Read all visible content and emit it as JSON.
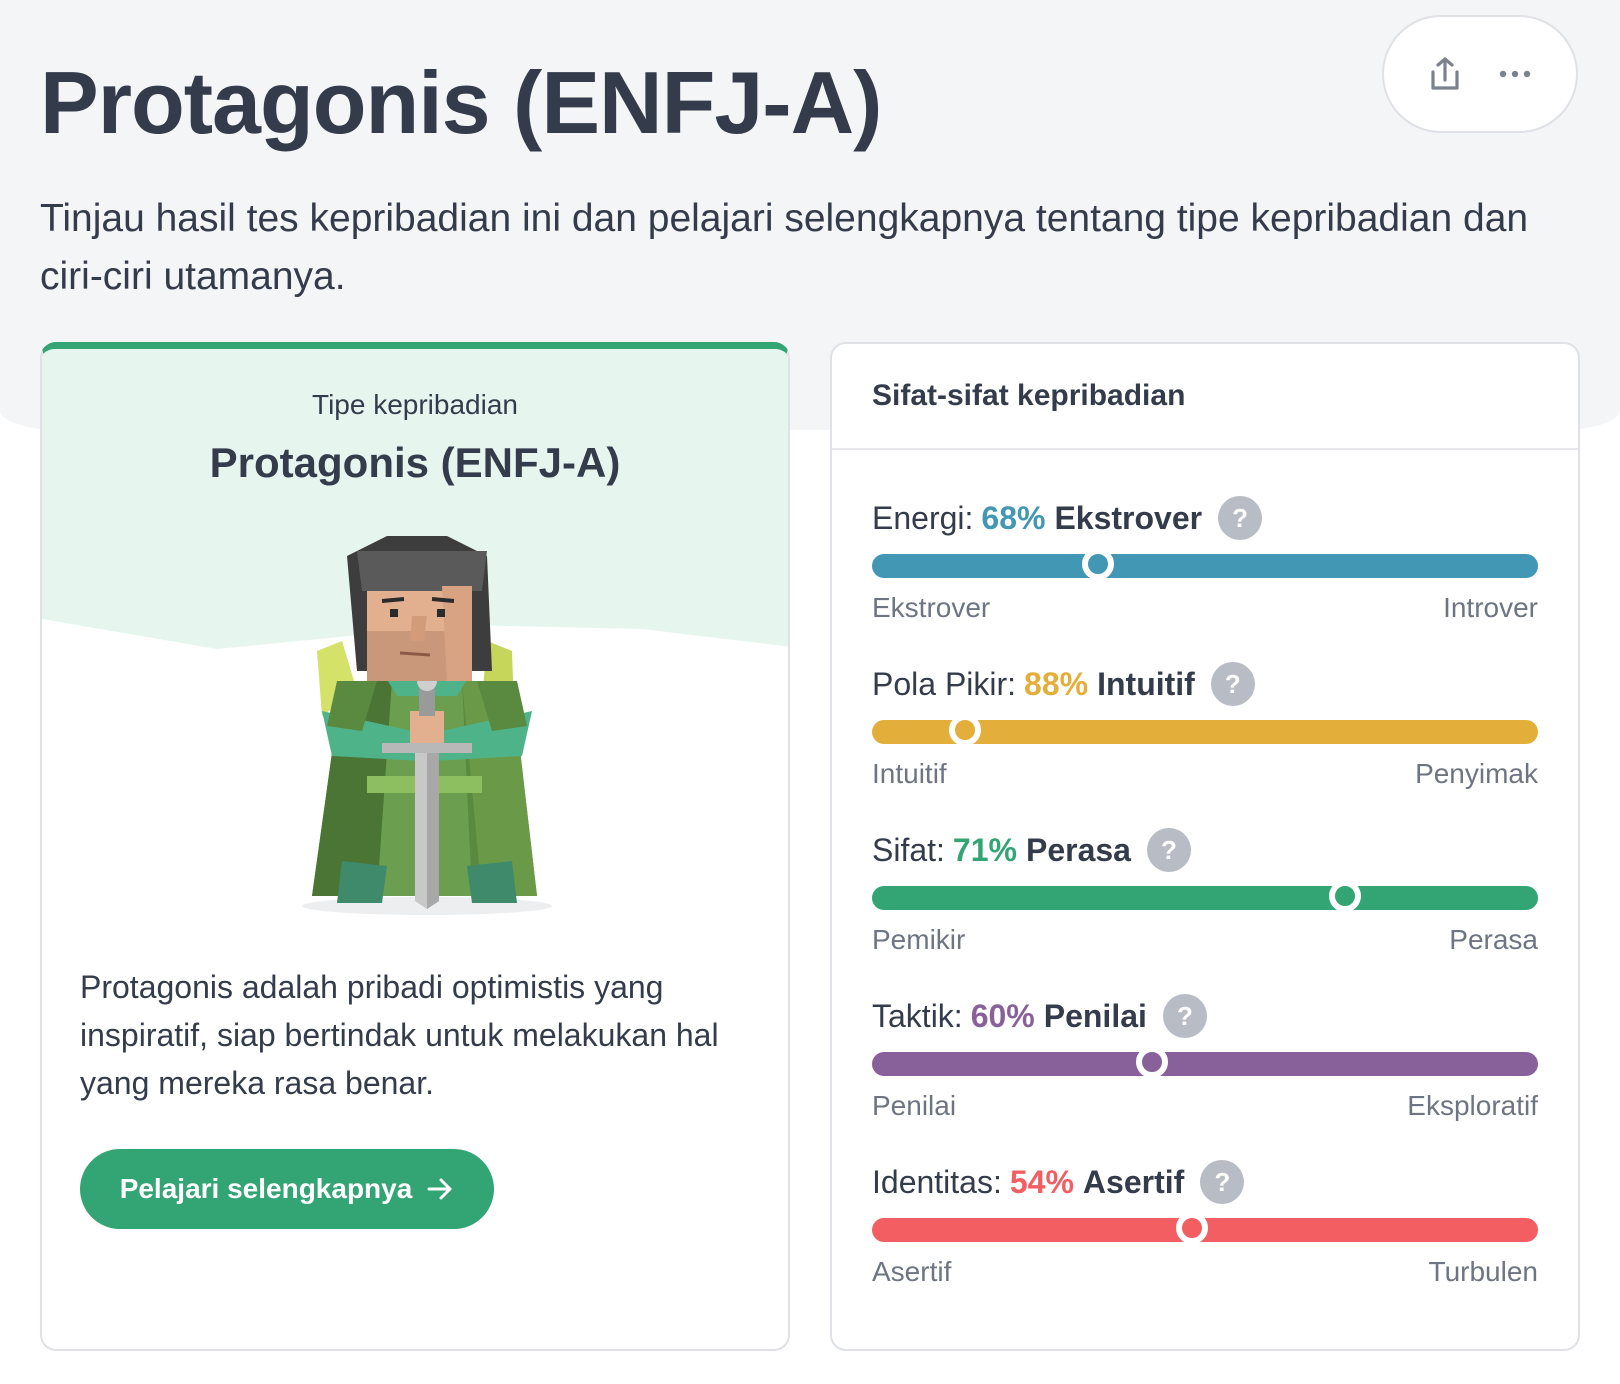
{
  "header": {
    "title": "Protagonis (ENFJ-A)",
    "subtitle": "Tinjau hasil tes kepribadian ini dan pelajari selengkapnya tentang tipe kepribadian dan ciri-ciri utamanya.",
    "share_icon": "share-icon",
    "more_icon": "more-horizontal-icon"
  },
  "type_card": {
    "label": "Tipe kepribadian",
    "name": "Protagonis (ENFJ-A)",
    "avatar_icon": "protagonist-character-illustration",
    "description": "Protagonis adalah pribadi optimistis yang inspiratif, siap bertindak untuk melakukan hal yang mereka rasa benar.",
    "button_label": "Pelajari selengkapnya",
    "button_icon": "arrow-right-icon",
    "accent": "#33a474"
  },
  "traits": {
    "title": "Sifat-sifat kepribadian",
    "items": [
      {
        "label": "Energi:",
        "percent": "68%",
        "trait": "Ekstrover",
        "left": "Ekstrover",
        "right": "Introver",
        "color": "#4298b4",
        "position": 0.34
      },
      {
        "label": "Pola Pikir:",
        "percent": "88%",
        "trait": "Intuitif",
        "left": "Intuitif",
        "right": "Penyimak",
        "color": "#e4ae3a",
        "position": 0.14
      },
      {
        "label": "Sifat:",
        "percent": "71%",
        "trait": "Perasa",
        "left": "Pemikir",
        "right": "Perasa",
        "color": "#33a474",
        "position": 0.71
      },
      {
        "label": "Taktik:",
        "percent": "60%",
        "trait": "Penilai",
        "left": "Penilai",
        "right": "Eksploratif",
        "color": "#88619a",
        "position": 0.42
      },
      {
        "label": "Identitas:",
        "percent": "54%",
        "trait": "Asertif",
        "left": "Asertif",
        "right": "Turbulen",
        "color": "#f25e62",
        "position": 0.48
      }
    ],
    "help_label": "?"
  }
}
